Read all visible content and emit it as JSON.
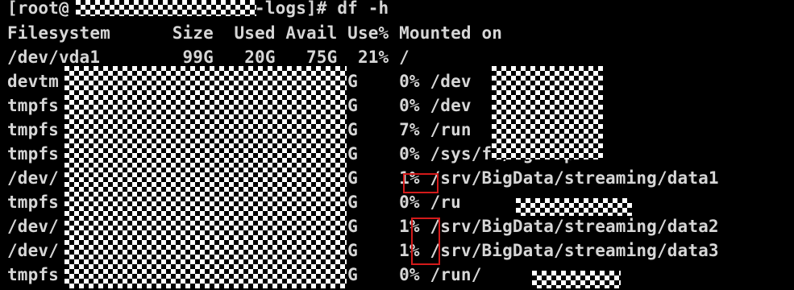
{
  "terminal": {
    "lines": [
      "[root@           K kafka-logs]# df -h",
      "Filesystem      Size  Used Avail Use% Mounted on",
      "/dev/vda1        99G   20G   75G  21% /",
      "devtm                          .9G    0% /dev",
      "tmpfs                          .9G    0% /dev",
      "tmpfs                          .4G    7% /run",
      "tmpfs                          .9G    0% /sys/fs/cgroup",
      "/dev/                          94G    1% /srv/BigData/streaming/data1",
      "tmpfs                          .6G    0% /ru",
      "/dev/                          .2G    1% /srv/BigData/streaming/data2",
      "/dev/                          .2G    1% /srv/BigData/streaming/data3",
      "tmpfs                          .6G    0% /run/"
    ]
  },
  "redactions": [
    {
      "label": "hostname-redaction"
    },
    {
      "label": "size-columns-redaction"
    },
    {
      "label": "mountpoint-redaction-top"
    },
    {
      "label": "mountpoint-redaction-row9"
    },
    {
      "label": "mountpoint-redaction-row12"
    }
  ],
  "highlights": [
    {
      "label": "use-percent-data1"
    },
    {
      "label": "use-percent-data2-data3"
    }
  ],
  "colors": {
    "background": "#000000",
    "text": "#d6d6d6",
    "highlight_border": "#d31a1a",
    "mask_light": "#ffffff",
    "mask_dark": "#000000"
  }
}
